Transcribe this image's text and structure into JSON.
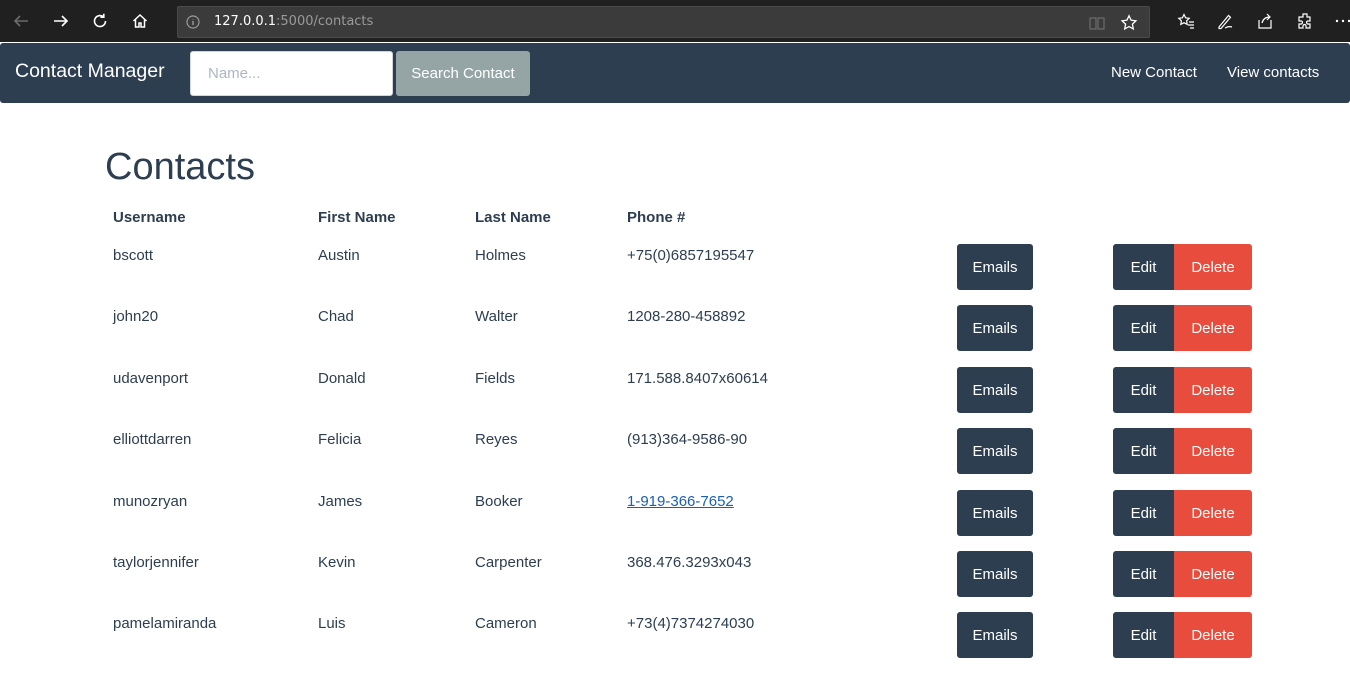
{
  "browser": {
    "url_host": "127.0.0.1",
    "url_path": ":5000/contacts"
  },
  "navbar": {
    "brand": "Contact Manager",
    "search_placeholder": "Name...",
    "search_button": "Search Contact",
    "links": [
      "New Contact",
      "View contacts"
    ]
  },
  "page": {
    "title": "Contacts"
  },
  "table": {
    "headers": [
      "Username",
      "First Name",
      "Last Name",
      "Phone #"
    ],
    "emails_label": "Emails",
    "edit_label": "Edit",
    "delete_label": "Delete",
    "rows": [
      {
        "username": "bscott",
        "first": "Austin",
        "last": "Holmes",
        "phone": "+75(0)6857195547"
      },
      {
        "username": "john20",
        "first": "Chad",
        "last": "Walter",
        "phone": "1208-280-458892"
      },
      {
        "username": "udavenport",
        "first": "Donald",
        "last": "Fields",
        "phone": "171.588.8407x60614"
      },
      {
        "username": "elliottdarren",
        "first": "Felicia",
        "last": "Reyes",
        "phone": "(913)364-9586-90"
      },
      {
        "username": "munozryan",
        "first": "James",
        "last": "Booker",
        "phone": "1-919-366-7652"
      },
      {
        "username": "taylorjennifer",
        "first": "Kevin",
        "last": "Carpenter",
        "phone": "368.476.3293x043"
      },
      {
        "username": "pamelamiranda",
        "first": "Luis",
        "last": "Cameron",
        "phone": "+73(4)7374274030"
      }
    ]
  }
}
